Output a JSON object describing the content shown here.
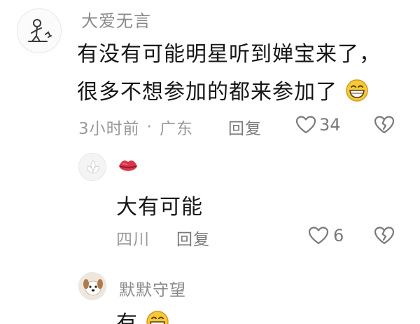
{
  "comment": {
    "username": "大爱无言",
    "line1": "有没有可能明星听到婵宝来了，",
    "line2": "很多不想参加的都来参加了",
    "time": "3小时前",
    "separator": "·",
    "location": "广东",
    "reply_label": "回复",
    "likes": "34",
    "avatar_icon": "stick-figure-sketch-icon",
    "emoji_icon": "grinning-emoji-icon"
  },
  "reply1": {
    "badge_icon": "red-lips-icon",
    "text": "大有可能",
    "location": "四川",
    "reply_label": "回复",
    "likes": "6",
    "avatar_icon": "white-flower-avatar"
  },
  "reply2": {
    "username": "默默守望",
    "text": "有",
    "avatar_icon": "puppy-avatar",
    "emoji_icon": "grinning-emoji-icon"
  },
  "colors": {
    "username": "#8a8a8a",
    "content": "#161616",
    "meta": "#9a9a9a",
    "lips": "#d9364a",
    "emoji_face": "#f5c938"
  }
}
